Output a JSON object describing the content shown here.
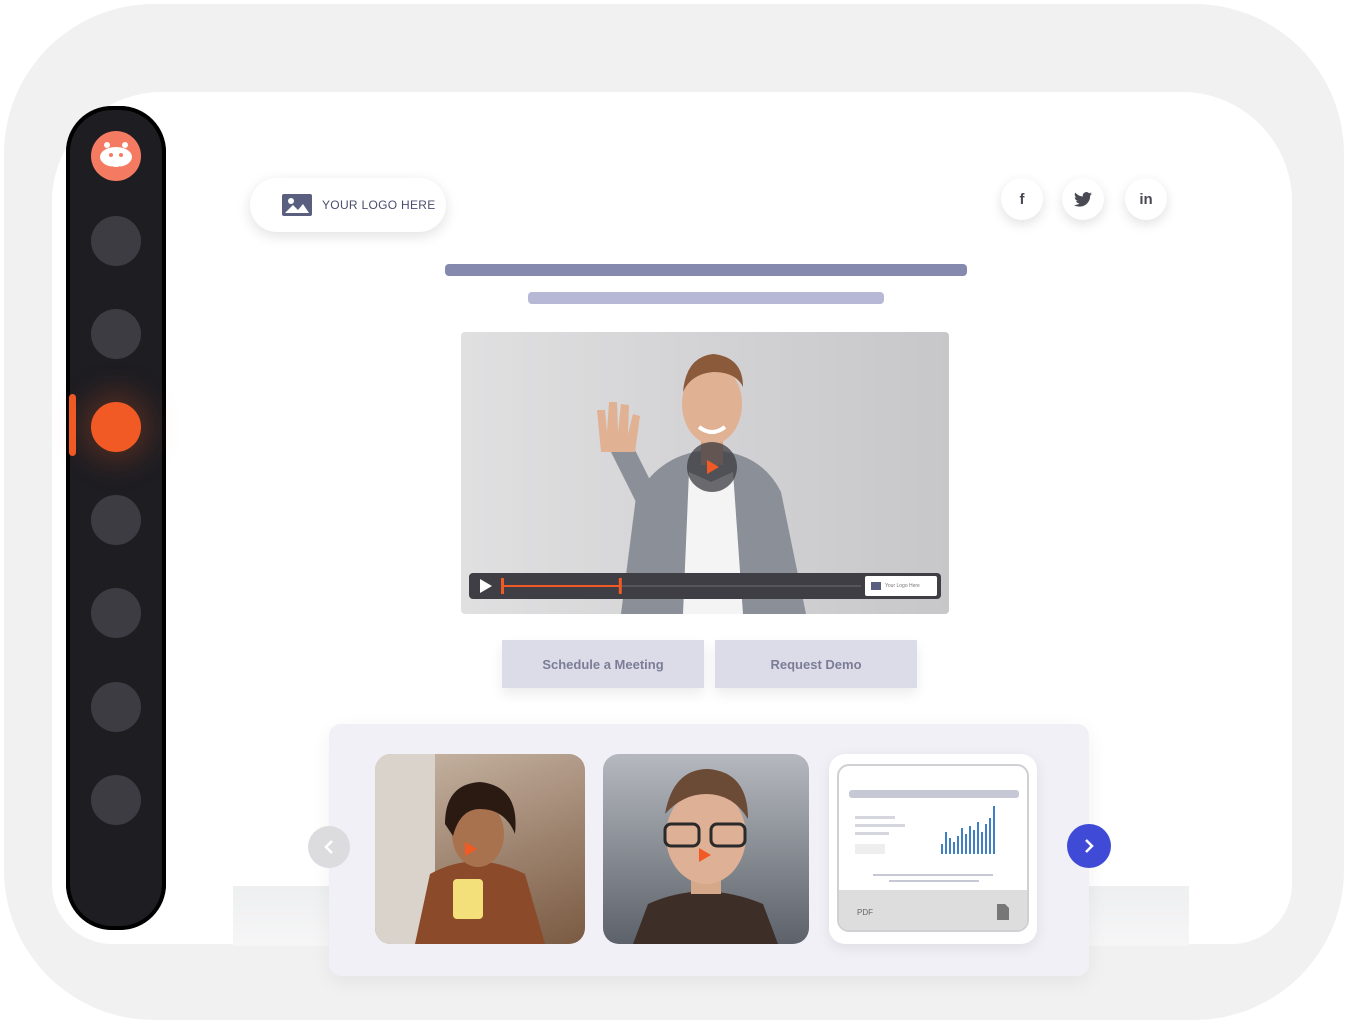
{
  "header": {
    "logo_label": "YOUR LOGO HERE",
    "social": [
      {
        "icon": "facebook-icon",
        "label": "f"
      },
      {
        "icon": "twitter-icon",
        "label": ""
      },
      {
        "icon": "linkedin-icon",
        "label": "in"
      }
    ]
  },
  "video": {
    "progress": 0.33,
    "mini_logo_label": "Your Logo Here"
  },
  "actions": {
    "schedule_label": "Schedule a Meeting",
    "demo_label": "Request Demo"
  },
  "carousel": {
    "pdf_label": "PDF"
  },
  "colors": {
    "accent": "#f15a24",
    "sidebar_bg": "#1d1d22",
    "next_button": "#3f4bd6"
  }
}
